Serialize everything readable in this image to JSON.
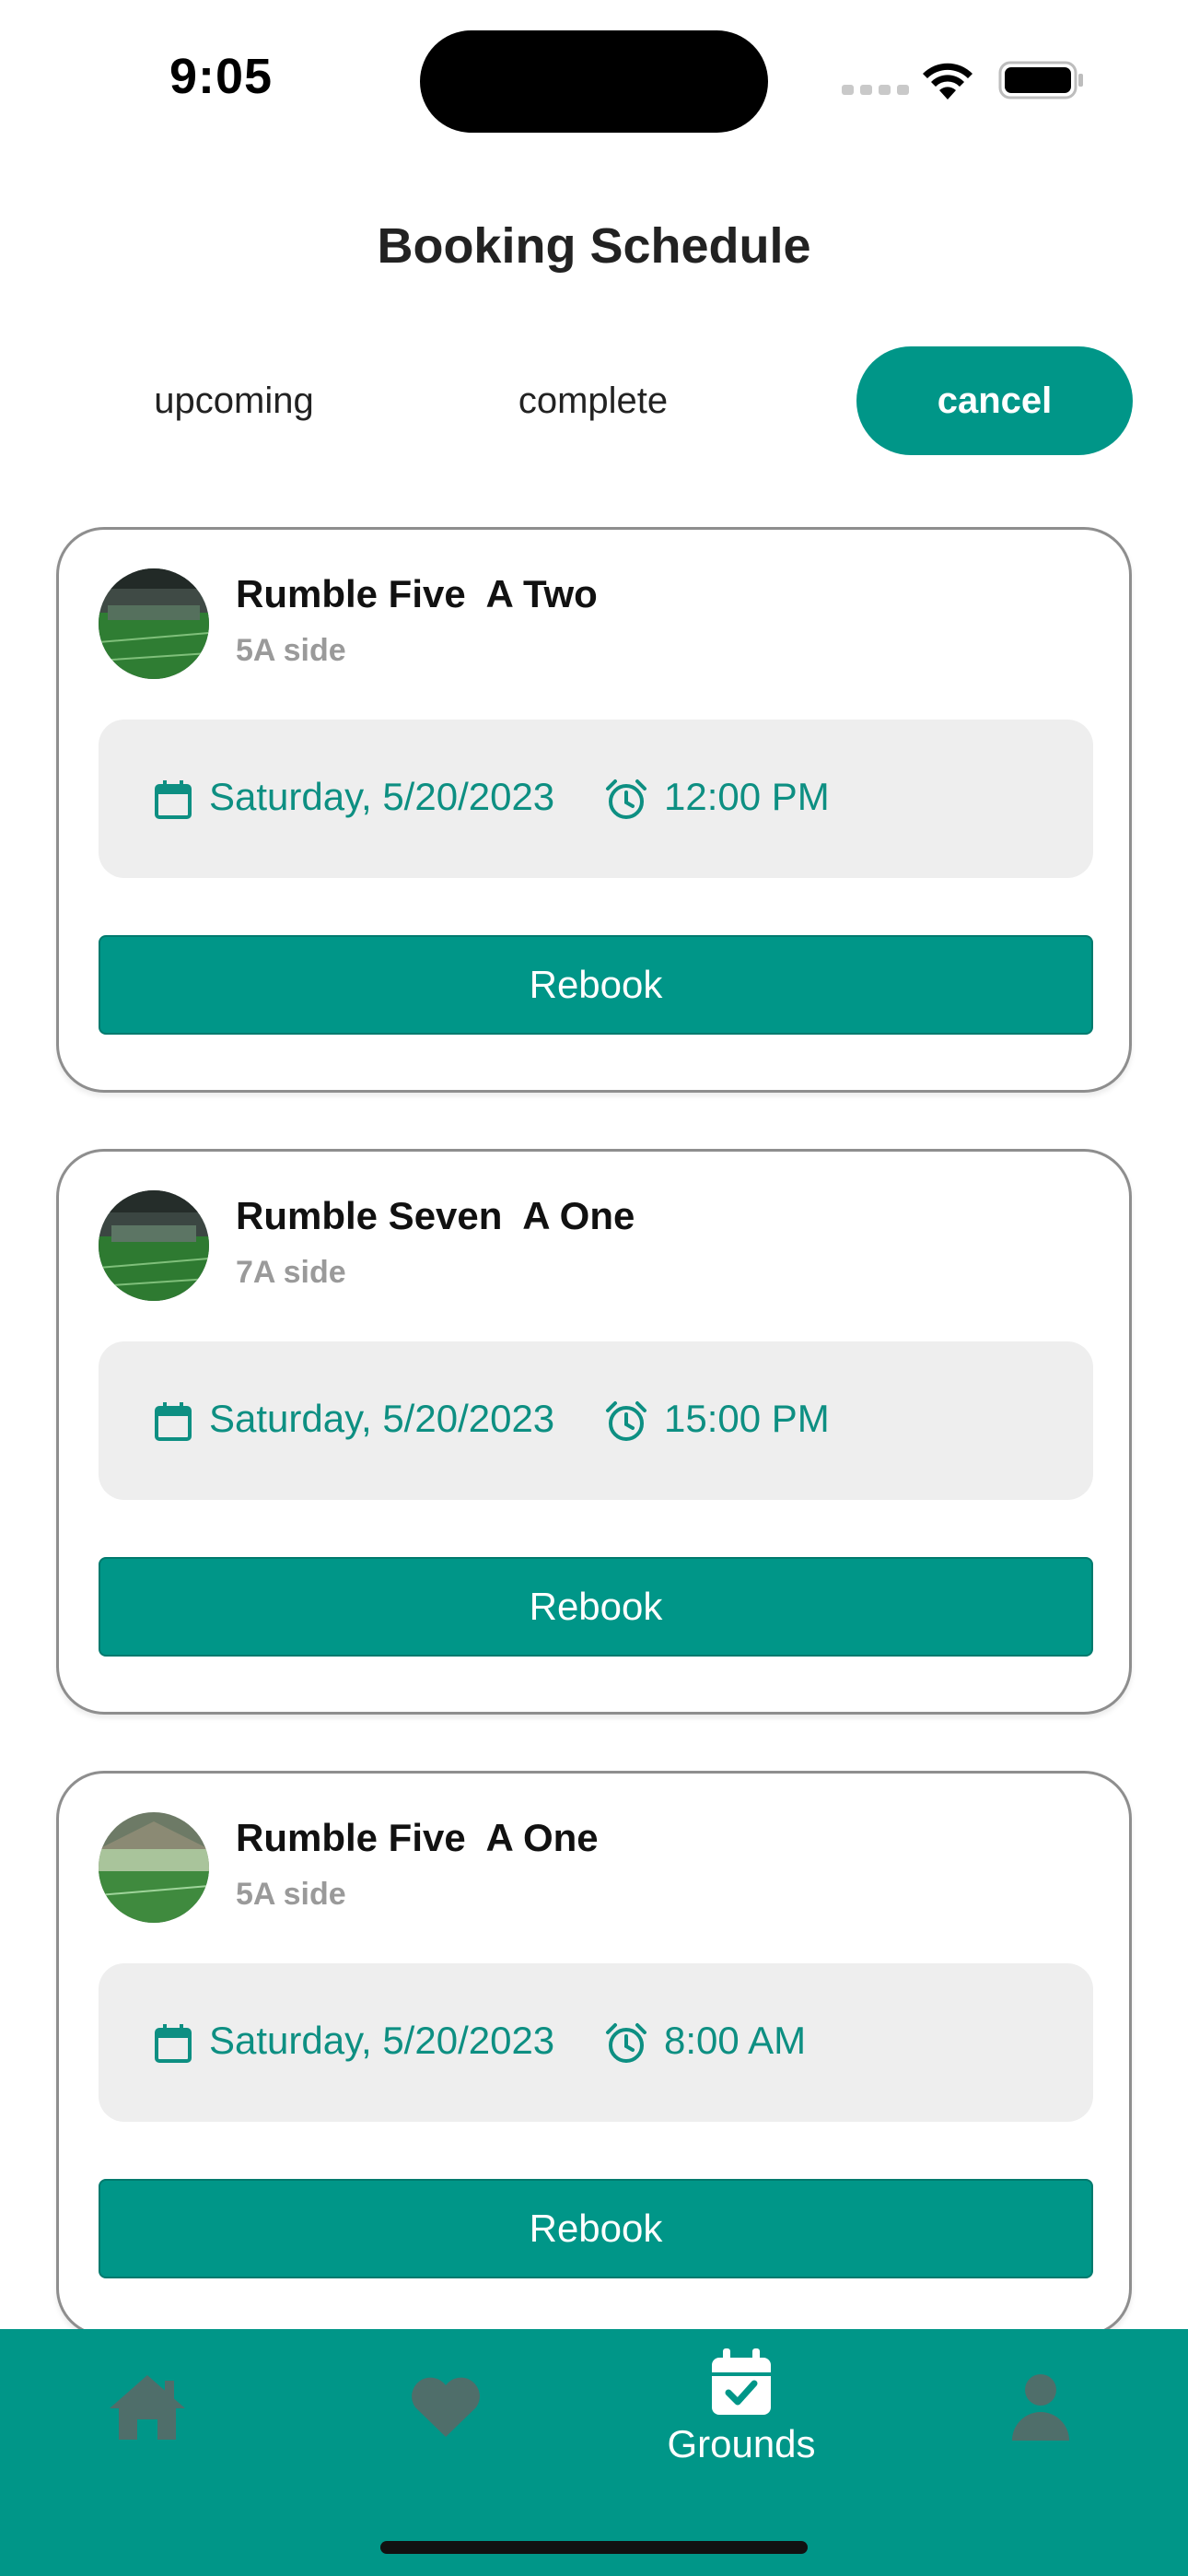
{
  "status_bar": {
    "time": "9:05"
  },
  "header": {
    "title": "Booking Schedule"
  },
  "tabs": [
    {
      "label": "upcoming",
      "active": false
    },
    {
      "label": "complete",
      "active": false
    },
    {
      "label": "cancel",
      "active": true
    }
  ],
  "bookings": [
    {
      "name": "Rumble Five  A Two",
      "type": "5A side",
      "date": "Saturday, 5/20/2023",
      "time": "12:00 PM",
      "action": "Rebook"
    },
    {
      "name": "Rumble Seven  A One",
      "type": "7A side",
      "date": "Saturday, 5/20/2023",
      "time": "15:00 PM",
      "action": "Rebook"
    },
    {
      "name": "Rumble Five  A One",
      "type": "5A side",
      "date": "Saturday, 5/20/2023",
      "time": "8:00 AM",
      "action": "Rebook"
    }
  ],
  "bottom_nav": {
    "items": [
      {
        "icon": "home-icon",
        "label": ""
      },
      {
        "icon": "heart-icon",
        "label": ""
      },
      {
        "icon": "calendar-check-icon",
        "label": "Grounds",
        "active": true
      },
      {
        "icon": "person-icon",
        "label": ""
      }
    ]
  },
  "colors": {
    "accent": "#009688",
    "accent_text": "#0d8f82",
    "inactive_icon": "#4f6e6a",
    "slot_bg": "#eeeeee"
  }
}
